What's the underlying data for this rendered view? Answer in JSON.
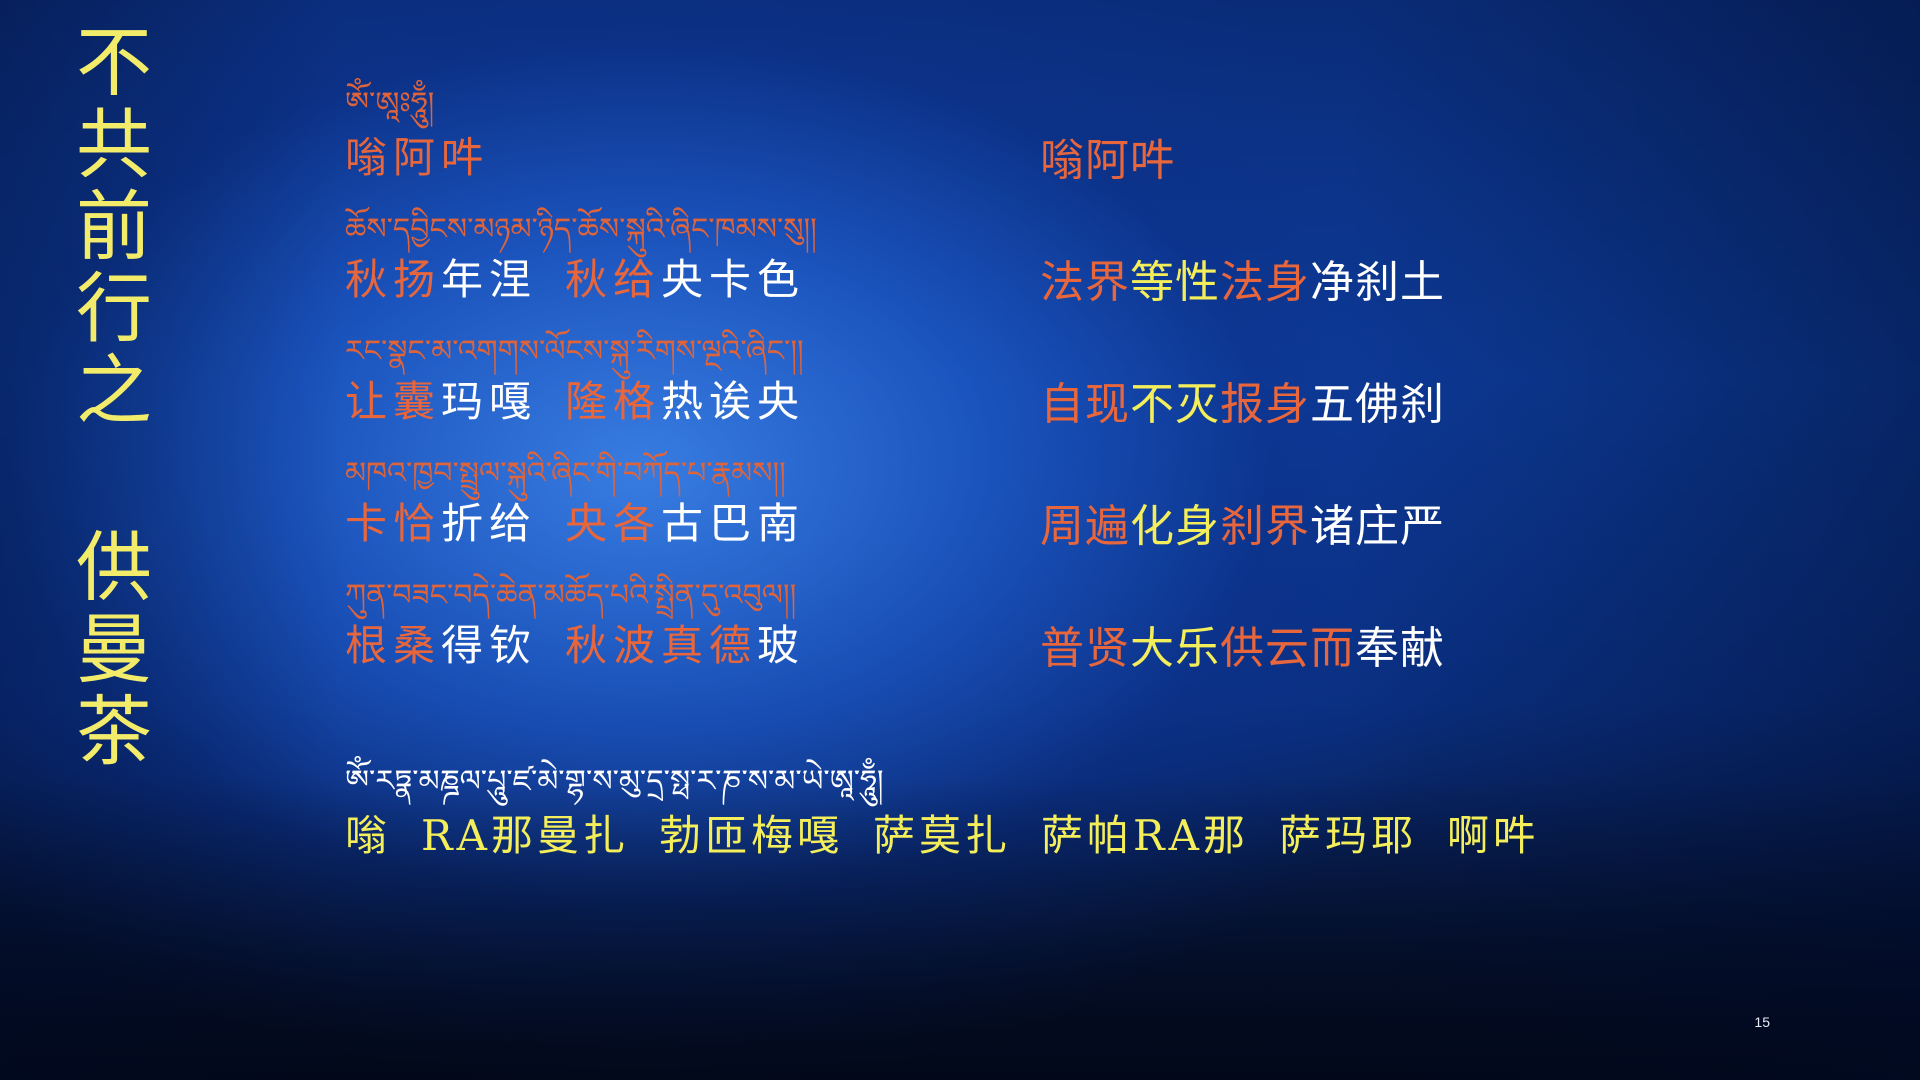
{
  "title": "不共前行之 供曼茶",
  "opening": {
    "tibetan": "ཨོཾ་ཨཱཿཧཱུྃ།",
    "chinese": "嗡阿吽",
    "translation": "嗡阿吽"
  },
  "verses": [
    {
      "tibetan": "ཆོས་དབྱིངས་མཉམ་ཉིད་ཆོས་སྐུའི་ཞིང་ཁམས་སུ།།",
      "chinese": [
        {
          "text": "秋扬",
          "color": "orange"
        },
        {
          "text": "年涅",
          "color": "white"
        },
        {
          "text": "秋给",
          "color": "orange"
        },
        {
          "text": "央卡色",
          "color": "white"
        }
      ],
      "translation": [
        {
          "text": "法界",
          "color": "orange"
        },
        {
          "text": "等性",
          "color": "yellow"
        },
        {
          "text": "法身",
          "color": "orange"
        },
        {
          "text": "净刹土",
          "color": "white"
        }
      ]
    },
    {
      "tibetan": "རང་སྣང་མ་འགགས་ལོངས་སྐུ་རིགས་ལྔའི་ཞིང་།།",
      "chinese": [
        {
          "text": "让囊",
          "color": "orange"
        },
        {
          "text": "玛嘎",
          "color": "white"
        },
        {
          "text": "隆格",
          "color": "orange"
        },
        {
          "text": "热诶央",
          "color": "white"
        }
      ],
      "translation": [
        {
          "text": "自现",
          "color": "orange"
        },
        {
          "text": "不灭",
          "color": "yellow"
        },
        {
          "text": "报身",
          "color": "orange"
        },
        {
          "text": "五佛刹",
          "color": "white"
        }
      ]
    },
    {
      "tibetan": "མཁའ་ཁྱབ་སྤྲུལ་སྐུའི་ཞིང་གི་བཀོད་པ་རྣམས།།",
      "chinese": [
        {
          "text": "卡恰",
          "color": "orange"
        },
        {
          "text": "折给",
          "color": "white"
        },
        {
          "text": "央各",
          "color": "orange"
        },
        {
          "text": "古巴南",
          "color": "white"
        }
      ],
      "translation": [
        {
          "text": "周遍",
          "color": "orange"
        },
        {
          "text": "化身",
          "color": "yellow"
        },
        {
          "text": "刹界",
          "color": "orange"
        },
        {
          "text": "诸庄严",
          "color": "white"
        }
      ]
    },
    {
      "tibetan": "ཀུན་བཟང་བདེ་ཆེན་མཆོད་པའི་སྤྲིན་དུ་འབུལ།།",
      "chinese": [
        {
          "text": "根桑",
          "color": "orange"
        },
        {
          "text": "得钦",
          "color": "white"
        },
        {
          "text": "秋波真德",
          "color": "orange"
        },
        {
          "text": "玻",
          "color": "white"
        }
      ],
      "translation": [
        {
          "text": "普贤",
          "color": "orange"
        },
        {
          "text": "大乐",
          "color": "yellow"
        },
        {
          "text": "供云而",
          "color": "orange"
        },
        {
          "text": "奉献",
          "color": "white"
        }
      ]
    }
  ],
  "mantra": {
    "tibetan": "ཨོཾ་རཏྣ་མཎྜལ་པཱུ་ཛ་མེ་གྷ་ས་མུ་དྲ་སྥ་ར་ཎ་ས་མ་ཡེ་ཨཱ་ཧཱུྃ།",
    "parts": [
      "嗡",
      "RA那曼扎",
      "勃匝梅嘎",
      "萨莫扎",
      "萨帕RA那",
      "萨玛耶",
      "啊吽"
    ]
  },
  "colors": {
    "orange": "#e8663c",
    "white": "#ffffff",
    "yellow": "#f4ee5a",
    "title": "#f2ec6a"
  },
  "page_number": "15"
}
